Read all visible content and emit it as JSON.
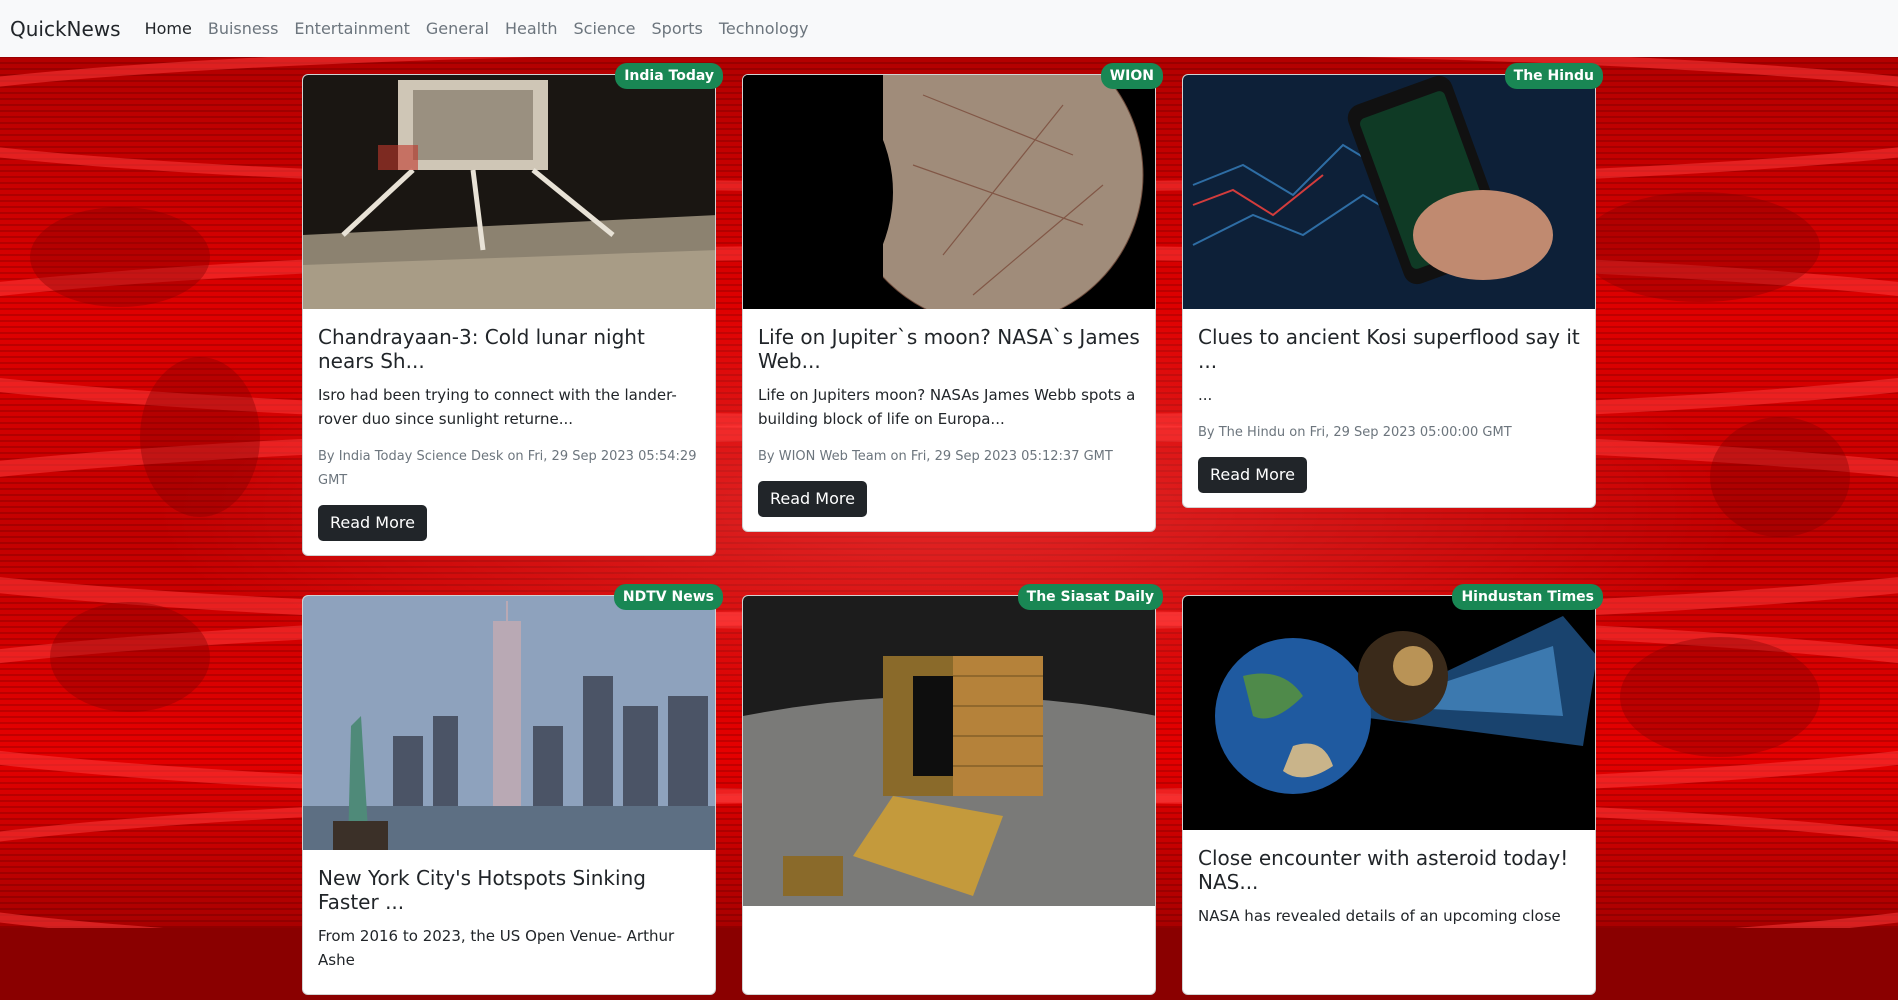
{
  "navbar": {
    "brand": "QuickNews",
    "links": [
      "Home",
      "Buisness",
      "Entertainment",
      "General",
      "Health",
      "Science",
      "Sports",
      "Technology"
    ]
  },
  "read_more_label": "Read More",
  "articles": [
    {
      "source": "India Today",
      "title": "Chandrayaan-3: Cold lunar night nears Sh...",
      "description": "Isro had been trying to connect with the lander-rover duo since sunlight returne...",
      "meta": "By India Today Science Desk on Fri, 29 Sep 2023 05:54:29 GMT"
    },
    {
      "source": "WION",
      "title": "Life on Jupiter`s moon? NASA`s James Web...",
      "description": "Life on Jupiters moon? NASAs James Webb spots a building block of life on Europa...",
      "meta": "By WION Web Team on Fri, 29 Sep 2023 05:12:37 GMT"
    },
    {
      "source": "The Hindu",
      "title": "Clues to ancient Kosi superflood say it ...",
      "description": "...",
      "meta": "By The Hindu on Fri, 29 Sep 2023 05:00:00 GMT"
    },
    {
      "source": "NDTV News",
      "title": "New York City's Hotspots Sinking Faster ...",
      "description": "From 2016 to 2023, the US Open Venue- Arthur Ashe",
      "meta": ""
    },
    {
      "source": "The Siasat Daily",
      "title": "",
      "description": "",
      "meta": ""
    },
    {
      "source": "Hindustan Times",
      "title": "Close encounter with asteroid today! NAS...",
      "description": "NASA has revealed details of an upcoming close",
      "meta": ""
    }
  ],
  "colors": {
    "badge": "#198754",
    "button": "#212529",
    "navbar": "#f8f9fa",
    "background": "#d00000"
  }
}
